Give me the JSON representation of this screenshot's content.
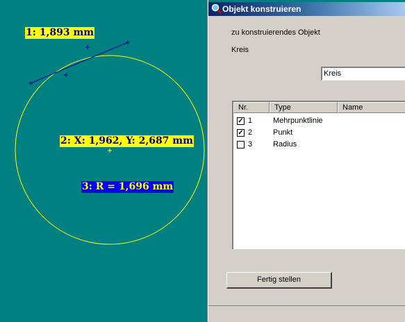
{
  "canvas": {
    "measurements": {
      "m1": "1: 1,893 mm",
      "m2": "2: X: 1,962, Y: 2,687 mm",
      "m3": "3: R = 1,696  mm"
    }
  },
  "dialog": {
    "title": "Objekt konstruieren",
    "label_object": "zu konstruierendes Objekt",
    "object_type": "Kreis",
    "name_value": "Kreis",
    "columns": [
      "Nr.",
      "Type",
      "Name"
    ],
    "rows": [
      {
        "nr": "1",
        "type": "Mehrpunktlinie",
        "checked": true
      },
      {
        "nr": "2",
        "type": "Punkt",
        "checked": true
      },
      {
        "nr": "3",
        "type": "Radius",
        "checked": false
      }
    ],
    "finish_button": "Fertig stellen"
  },
  "colors": {
    "canvas_bg": "#008080",
    "circle": "#ffff00",
    "line": "#0000aa",
    "dialog_bg": "#d4d0c8"
  }
}
